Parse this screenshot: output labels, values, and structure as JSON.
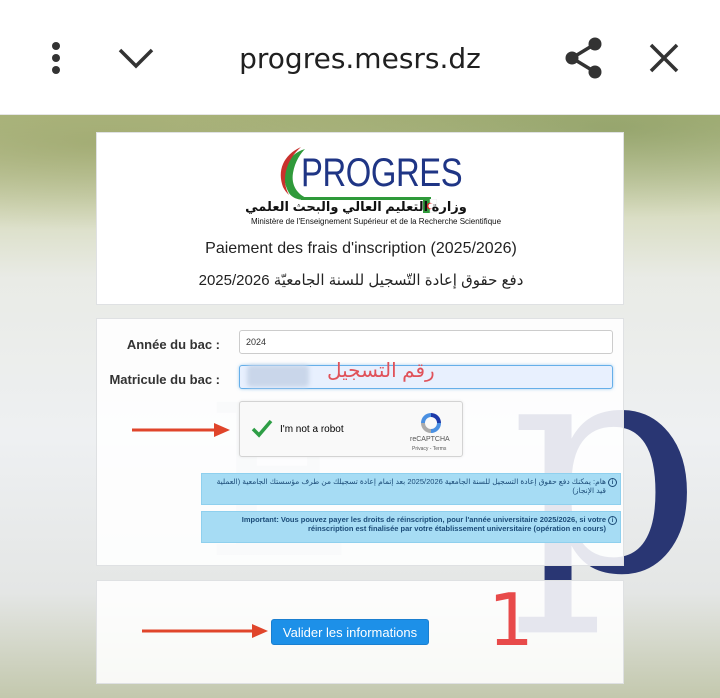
{
  "browser": {
    "url": "progres.mesrs.dz",
    "icons": [
      "more-vert-icon",
      "chevron-down-icon",
      "share-icon",
      "close-icon"
    ]
  },
  "header": {
    "logo_text": "PROGRES",
    "ministry_ar": "وزارة التعليم العالي والبحث العلمي",
    "ministry_fr": "Ministère de l'Enseignement Supérieur et de la Recherche Scientifique",
    "title_fr": "Paiement des frais d'inscription (2025/2026)",
    "title_ar": "دفع حقوق إعادة التّسجيل للسنة الجامعيّة 2025/2026"
  },
  "form": {
    "bac_year_label": "Année du bac :",
    "bac_year_value": "2024",
    "matricule_label": "Matricule du bac :",
    "matricule_overlay": "رقم التسجيل",
    "captcha": {
      "label": "I'm not a robot",
      "brand": "reCAPTCHA",
      "links": "Privacy - Terms",
      "checked": true
    },
    "alert_ar": "هام: يمكنك دفع حقوق إعادة التسجيل للسنة الجامعية 2025/2026 بعد إتمام إعادة تسجيلك من طرف مؤسستك الجامعية (العملية قيد الإنجاز)",
    "alert_fr": "Important: Vous pouvez payer les droits de réinscription, pour l'année universitaire 2025/2026, si votre réinscription est finalisée par votre établissement universitaire (opération en cours)",
    "info_glyph": "i"
  },
  "actions": {
    "validate_label": "Valider les informations"
  },
  "annotation": {
    "step_number": "1",
    "color": "#e84a4a"
  }
}
